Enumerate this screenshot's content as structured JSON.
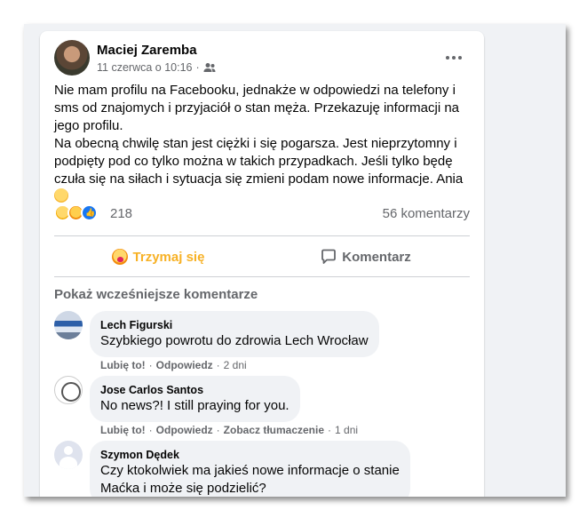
{
  "post": {
    "author": "Maciej Zaremba",
    "date": "11 czerwca o 10:16",
    "audience_icon": "friends-icon",
    "more_icon": "more-horizontal-icon",
    "text_lines_1": "Nie mam profilu na Facebooku, jednakże w odpowiedzi na telefony i sms od znajomych i przyjaciół  o stan męża. Przekazuję informacji na jego profilu.",
    "text_lines_2": "Na obecną chwilę stan jest ciężki i się pogarsza. Jest nieprzytomny i podpięty pod co tylko można w takich przypadkach. Jeśli tylko będę czuła się na siłach i sytuacja się zmieni podam nowe informacje. Ania",
    "reaction_count": "218",
    "comment_count": "56 komentarzy",
    "actions": {
      "react_label": "Trzymaj się",
      "comment_label": "Komentarz"
    },
    "show_earlier": "Pokaż wcześniejsze komentarze"
  },
  "comments": [
    {
      "name": "Lech Figurski",
      "text": "Szybkiego powrotu do zdrowia Lech Wrocław",
      "like": "Lubię to!",
      "reply": "Odpowiedz",
      "time": "2 dni"
    },
    {
      "name": "Jose Carlos Santos",
      "text": "No news?! I still praying for you.",
      "like": "Lubię to!",
      "reply": "Odpowiedz",
      "translate": "Zobacz tłumaczenie",
      "time": "1 dni"
    },
    {
      "name": "Szymon Dędek",
      "text_1": "Czy ktokolwiek ma jakieś nowe informacje o stanie",
      "text_2": "Maćka i może się podzielić?"
    }
  ],
  "colors": {
    "accent_react": "#f7b125",
    "background": "#f0f2f5",
    "like_blue": "#1877f2"
  }
}
